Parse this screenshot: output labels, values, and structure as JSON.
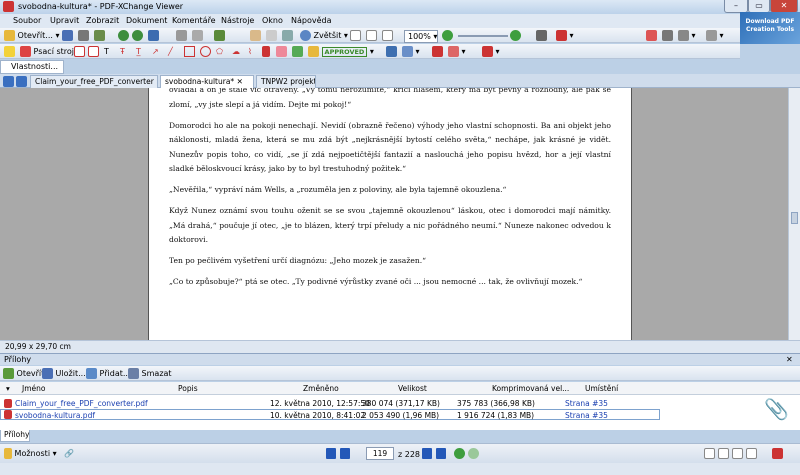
{
  "window": {
    "title": "svobodna-kultura* - PDF-XChange Viewer",
    "logo": "Download PDF Creation Tools"
  },
  "menu": [
    "Soubor",
    "Upravit",
    "Zobrazit",
    "Dokument",
    "Komentáře",
    "Nástroje",
    "Okno",
    "Nápověda"
  ],
  "toolbar1": {
    "open": "Otevřít...",
    "zoom_fit": "Zvětšit",
    "zoom": "100%"
  },
  "toolbar2": {
    "typewriter": "Psací stroj",
    "stamp": "APPROVED"
  },
  "side_tab": "Vlastnosti...",
  "tabs": [
    "Claim_your_free_PDF_converter",
    "svobodna-kultura*",
    "TNPW2 projekt"
  ],
  "document": {
    "paragraphs": [
      "ovládal a on je stále víc otrávený. „Vy tomu nerozumíte,“ křičí hlasem, který má být pevný a rozhodný, ale pak se zlomí, „vy jste slepí a já vidím. Dejte mi pokoj!“",
      "Domorodci ho ale na pokoji nenechají. Nevidí (obrazně řečeno) výhody jeho vlastní schopnosti. Ba ani objekt jeho náklonosti, mladá žena, která se mu zdá být „nejkrásnější bytostí celého světa,“ nechápe, jak krásné je vidět. Nunezův popis toho, co vidí, „se jí zdá nejpoetičtější fantazií a naslouchá jeho popisu hvězd, hor a její vlastní sladké běloskvoucí krásy, jako by to byl trestuhodný požitek.“",
      "„Nevěřila,“ vypráví nám Wells, a „rozuměla jen z poloviny, ale byla tajemně okouzlena.“",
      "Když Nunez oznámí svou touhu oženit se se svou „tajemně okouzlenou“ láskou, otec i domorodci mají námitky. „Má drahá,“ poučuje jí otec, „je to blázen, který trpí přeludy a nic pořádného neumí.“ Nuneze nakonec odvedou k doktorovi.",
      "Ten po pečlivém vyšetření určí diagnózu: „Jeho mozek je zasažen.“",
      "„Co to způsobuje?“ ptá se otec. „Ty podivné výrůstky zvané oči ... jsou nemocné ... tak, že ovlivňují mozek.“"
    ]
  },
  "status": {
    "page_size": "20,99 x 29,70 cm"
  },
  "attachments": {
    "title": "Přílohy",
    "toolbar": {
      "open": "Otevřít",
      "save": "Uložit...",
      "add": "Přidat...",
      "delete": "Smazat"
    },
    "columns": [
      "Jméno",
      "Popis",
      "Změněno",
      "Velikost",
      "Komprimovaná vel...",
      "Umístění"
    ],
    "rows": [
      {
        "name": "Claim_your_free_PDF_converter.pdf",
        "desc": "",
        "modified": "12. května 2010, 12:57:50",
        "size": "380 074 (371,17 KB)",
        "compressed": "375 783 (366,98 KB)",
        "location": "Strana #35"
      },
      {
        "name": "svobodna-kultura.pdf",
        "desc": "",
        "modified": "10. května 2010, 8:41:02",
        "size": "2 053 490 (1,96 MB)",
        "compressed": "1 916 724 (1,83 MB)",
        "location": "Strana #35"
      }
    ],
    "tab": "Přílohy"
  },
  "nav": {
    "options": "Možnosti",
    "page": "119",
    "total": "z 228"
  }
}
